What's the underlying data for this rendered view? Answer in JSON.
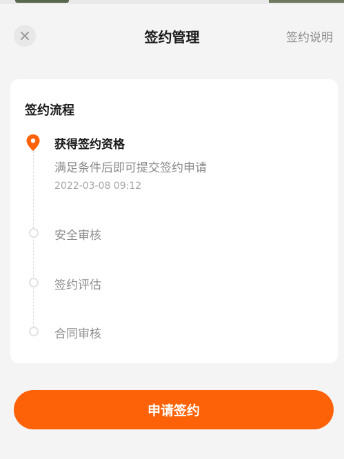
{
  "header": {
    "title": "签约管理",
    "help_label": "签约说明",
    "close_icon": "close-icon"
  },
  "card": {
    "title": "签约流程",
    "steps": [
      {
        "label": "获得签约资格",
        "description": "满足条件后即可提交签约申请",
        "time": "2022-03-08 09:12",
        "status": "active"
      },
      {
        "label": "安全审核",
        "status": "pending"
      },
      {
        "label": "签约评估",
        "status": "pending"
      },
      {
        "label": "合同审核",
        "status": "pending"
      }
    ]
  },
  "footer": {
    "apply_label": "申请签约"
  },
  "colors": {
    "accent": "#fe6208",
    "background": "#f4f4f4",
    "card": "#ffffff",
    "muted_text": "#8c8c8c"
  }
}
